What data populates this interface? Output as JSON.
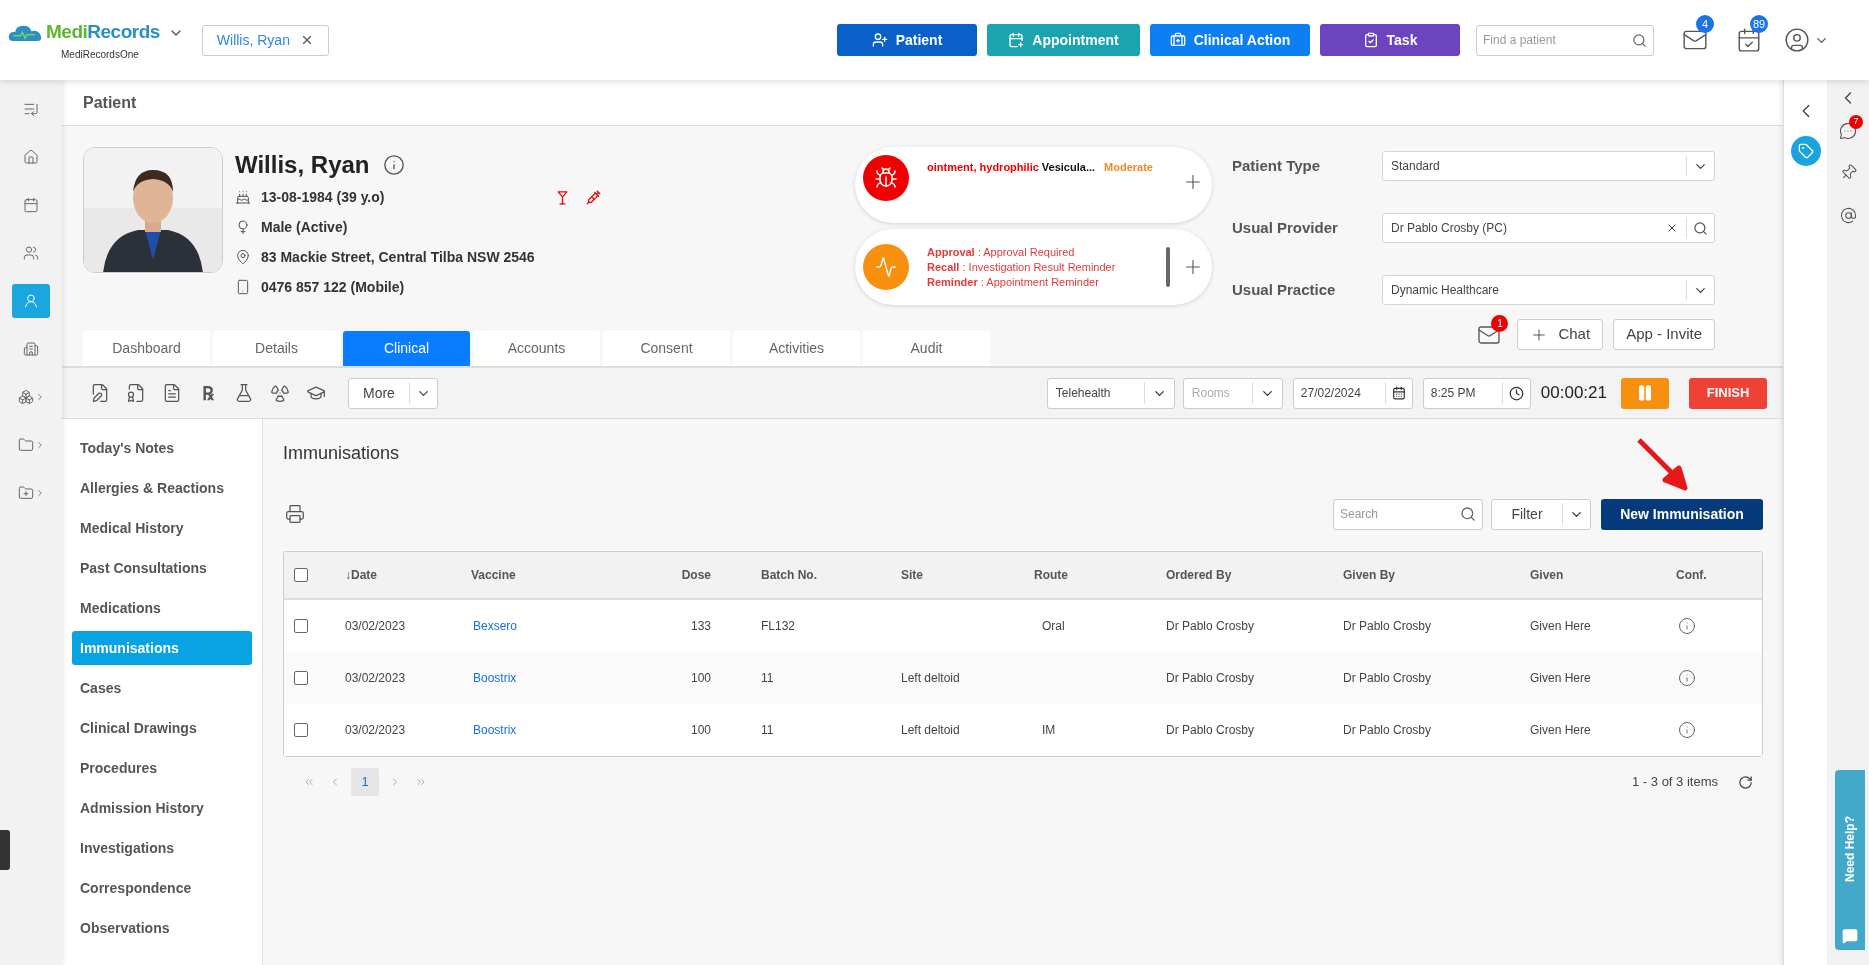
{
  "logo": {
    "brand_a": "Medi",
    "brand_b": "Records",
    "subtitle": "MediRecordsOne"
  },
  "open_patient_tab": {
    "label": "Willis, Ryan"
  },
  "header_buttons": [
    {
      "kind": "patient",
      "label": "Patient"
    },
    {
      "kind": "appointment",
      "label": "Appointment"
    },
    {
      "kind": "clinical",
      "label": "Clinical Action"
    },
    {
      "kind": "task",
      "label": "Task"
    }
  ],
  "patient_search": {
    "placeholder": "Find a patient"
  },
  "notifications": [
    {
      "kind": "mail",
      "count": "4"
    },
    {
      "kind": "tasks",
      "count": "89"
    }
  ],
  "nav_rail": [
    {
      "kind": "expand",
      "selected": false,
      "submenu": false
    },
    {
      "kind": "home",
      "selected": false,
      "submenu": false
    },
    {
      "kind": "calendar",
      "selected": false,
      "submenu": false
    },
    {
      "kind": "contacts",
      "selected": false,
      "submenu": false
    },
    {
      "kind": "patients",
      "selected": true,
      "submenu": false
    },
    {
      "kind": "building",
      "selected": false,
      "submenu": false
    },
    {
      "kind": "modules",
      "selected": false,
      "submenu": true
    },
    {
      "kind": "folder",
      "selected": false,
      "submenu": true
    },
    {
      "kind": "folder-add",
      "selected": false,
      "submenu": true
    }
  ],
  "page_title": "Patient",
  "patient": {
    "name": "Willis, Ryan",
    "details": [
      {
        "kind": "dob",
        "text": "13-08-1984 (39 y.o)"
      },
      {
        "kind": "gender",
        "text": "Male (Active)"
      },
      {
        "kind": "address",
        "text": "83 Mackie Street, Central Tilba NSW 2546"
      },
      {
        "kind": "phone",
        "text": "0476 857 122 (Mobile)"
      }
    ],
    "flags": [
      {
        "kind": "alcohol"
      },
      {
        "kind": "drug"
      }
    ]
  },
  "alerts": {
    "allergy": {
      "substance": "ointment, hydrophilic",
      "reaction": "Vesicula...",
      "severity": "Moderate"
    },
    "reminders": [
      {
        "type": "Approval",
        "text": ": Approval Required"
      },
      {
        "type": "Recall",
        "text": ": Investigation Result Reminder"
      },
      {
        "type": "Reminder",
        "text": ": Appointment Reminder"
      }
    ]
  },
  "fields": [
    {
      "kind": "select",
      "label": "Patient Type",
      "value": "Standard"
    },
    {
      "kind": "lookup",
      "label": "Usual Provider",
      "value": "Dr Pablo Crosby (PC)"
    },
    {
      "kind": "select",
      "label": "Usual Practice",
      "value": "Dynamic Healthcare"
    }
  ],
  "messages": {
    "count": "1"
  },
  "chat_button": "Chat",
  "invite_button": "App - Invite",
  "tabs": [
    {
      "label": "Dashboard",
      "selected": false
    },
    {
      "label": "Details",
      "selected": false
    },
    {
      "label": "Clinical",
      "selected": true
    },
    {
      "label": "Accounts",
      "selected": false
    },
    {
      "label": "Consent",
      "selected": false
    },
    {
      "label": "Activities",
      "selected": false
    },
    {
      "label": "Audit",
      "selected": false
    }
  ],
  "tools": [
    {
      "kind": "note"
    },
    {
      "kind": "certificate"
    },
    {
      "kind": "report"
    },
    {
      "kind": "rx",
      "glyph": "℞"
    },
    {
      "kind": "lab"
    },
    {
      "kind": "radiology"
    },
    {
      "kind": "education"
    }
  ],
  "more_button": "More",
  "consult": {
    "type": "Telehealth",
    "rooms_placeholder": "Rooms",
    "date": "27/02/2024",
    "time": "8:25 PM",
    "timer": "00:00:21",
    "finish": "FINISH"
  },
  "menu": [
    {
      "label": "Today's Notes",
      "selected": false
    },
    {
      "label": "Allergies & Reactions",
      "selected": false
    },
    {
      "label": "Medical History",
      "selected": false
    },
    {
      "label": "Past Consultations",
      "selected": false
    },
    {
      "label": "Medications",
      "selected": false
    },
    {
      "label": "Immunisations",
      "selected": true
    },
    {
      "label": "Cases",
      "selected": false
    },
    {
      "label": "Clinical Drawings",
      "selected": false
    },
    {
      "label": "Procedures",
      "selected": false
    },
    {
      "label": "Admission History",
      "selected": false
    },
    {
      "label": "Investigations",
      "selected": false
    },
    {
      "label": "Correspondence",
      "selected": false
    },
    {
      "label": "Observations",
      "selected": false
    }
  ],
  "section": {
    "title": "Immunisations",
    "search_placeholder": "Search",
    "filter": "Filter",
    "new_button": "New Immunisation"
  },
  "table": {
    "all_checked": false,
    "columns": [
      {
        "label": "Date",
        "sort": "↓"
      },
      {
        "label": "Vaccine"
      },
      {
        "label": "Dose"
      },
      {
        "label": "Batch No."
      },
      {
        "label": "Site"
      },
      {
        "label": "Route"
      },
      {
        "label": "Ordered By"
      },
      {
        "label": "Given By"
      },
      {
        "label": "Given"
      },
      {
        "label": "Conf."
      }
    ],
    "rows": [
      {
        "checked": false,
        "date": "03/02/2023",
        "vaccine": "Bexsero",
        "dose": "133",
        "batch": "FL132",
        "route": "Oral",
        "ordered_by": "Dr Pablo Crosby",
        "given_by": "Dr Pablo Crosby",
        "given": "Given Here"
      },
      {
        "checked": false,
        "date": "03/02/2023",
        "vaccine": "Boostrix",
        "dose": "100",
        "batch": "11",
        "site": "Left deltoid",
        "ordered_by": "Dr Pablo Crosby",
        "given_by": "Dr Pablo Crosby",
        "given": "Given Here"
      },
      {
        "checked": false,
        "date": "03/02/2023",
        "vaccine": "Boostrix",
        "dose": "100",
        "batch": "11",
        "site": "Left deltoid",
        "route": "IM",
        "ordered_by": "Dr Pablo Crosby",
        "given_by": "Dr Pablo Crosby",
        "given": "Given Here"
      }
    ]
  },
  "pagination": {
    "pages": [
      {
        "label": "1",
        "selected": true
      }
    ],
    "summary": "1 - 3 of 3 items"
  },
  "side_panel": {
    "chat_count": "7"
  },
  "help_tab": "Need Help?"
}
